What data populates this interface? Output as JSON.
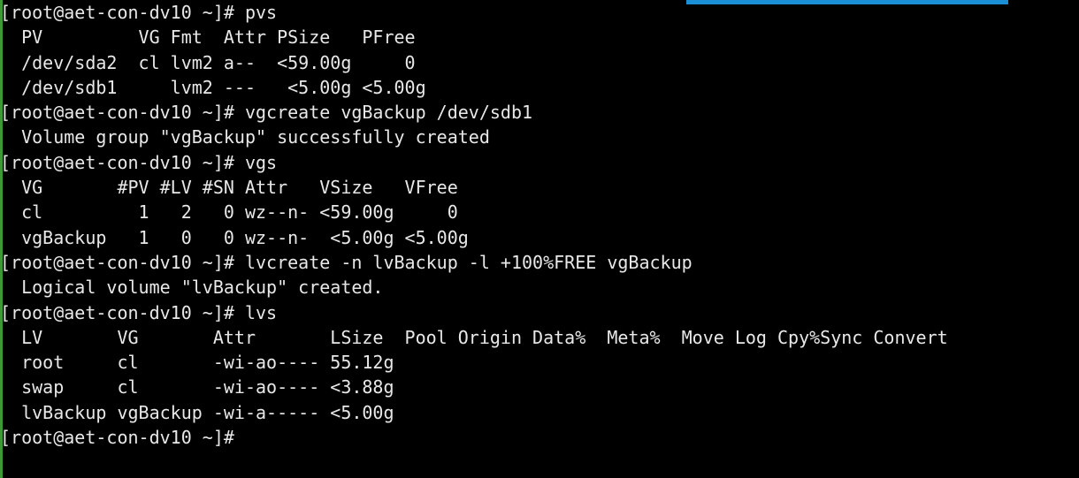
{
  "accent_colors": {
    "left_border": "#3a9a3a",
    "top_bar": "#1a8fd6",
    "text": "#e8e8e8",
    "background": "#000000"
  },
  "terminal": {
    "lines": [
      "[root@aet-con-dv10 ~]# pvs",
      "  PV         VG Fmt  Attr PSize   PFree",
      "  /dev/sda2  cl lvm2 a--  <59.00g     0",
      "  /dev/sdb1     lvm2 ---   <5.00g <5.00g",
      "[root@aet-con-dv10 ~]# vgcreate vgBackup /dev/sdb1",
      "  Volume group \"vgBackup\" successfully created",
      "[root@aet-con-dv10 ~]# vgs",
      "  VG       #PV #LV #SN Attr   VSize   VFree",
      "  cl         1   2   0 wz--n- <59.00g     0",
      "  vgBackup   1   0   0 wz--n-  <5.00g <5.00g",
      "[root@aet-con-dv10 ~]# lvcreate -n lvBackup -l +100%FREE vgBackup",
      "  Logical volume \"lvBackup\" created.",
      "[root@aet-con-dv10 ~]# lvs",
      "  LV       VG       Attr       LSize  Pool Origin Data%  Meta%  Move Log Cpy%Sync Convert",
      "  root     cl       -wi-ao---- 55.12g",
      "  swap     cl       -wi-ao---- <3.88g",
      "  lvBackup vgBackup -wi-a----- <5.00g",
      "[root@aet-con-dv10 ~]#"
    ]
  }
}
